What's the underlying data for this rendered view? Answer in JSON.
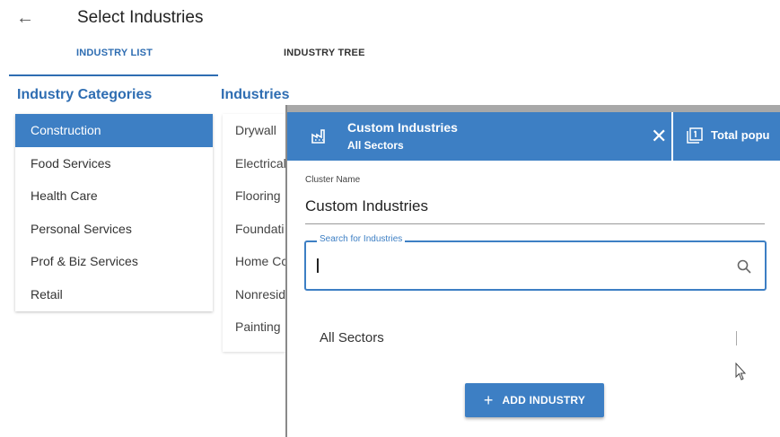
{
  "header": {
    "back_icon": "arrow-left-icon",
    "title": "Select Industries"
  },
  "tabs": [
    {
      "label": "INDUSTRY LIST",
      "active": true
    },
    {
      "label": "INDUSTRY TREE",
      "active": false
    }
  ],
  "categories": {
    "heading": "Industry Categories",
    "items": [
      {
        "label": "Construction",
        "selected": true
      },
      {
        "label": "Food Services",
        "selected": false
      },
      {
        "label": "Health Care",
        "selected": false
      },
      {
        "label": "Personal Services",
        "selected": false
      },
      {
        "label": "Prof & Biz Services",
        "selected": false
      },
      {
        "label": "Retail",
        "selected": false
      }
    ]
  },
  "industries": {
    "heading": "Industries",
    "items": [
      "Drywall",
      "Electrical",
      "Flooring",
      "Foundati",
      "Home Cc",
      "Nonresid",
      "Painting"
    ]
  },
  "dialog": {
    "title": "Custom Industries",
    "subtitle": "All Sectors",
    "header_icon": "factory-icon",
    "close_icon": "close-icon",
    "population_icon": "counter-icon",
    "population_label": "Total popu",
    "cluster_name_label": "Cluster Name",
    "cluster_name_value": "Custom Industries",
    "search": {
      "label": "Search for Industries",
      "value": "",
      "icon": "search-icon"
    },
    "sector_label": "All Sectors",
    "add_button_label": "ADD INDUSTRY"
  },
  "colors": {
    "primary": "#3d7fc4",
    "link": "#2e6db2"
  }
}
